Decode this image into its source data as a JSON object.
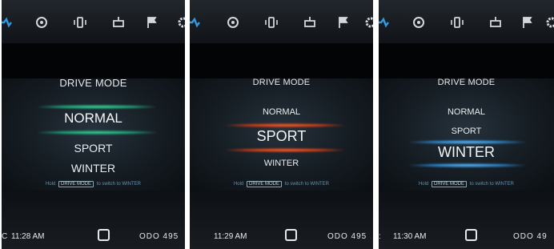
{
  "panels": [
    {
      "title": "DRIVE MODE",
      "options": [
        "NORMAL",
        "SPORT",
        "WINTER"
      ],
      "selected": "NORMAL",
      "selected_color": "#3fe0a4",
      "hint": {
        "prefix": "Hold",
        "key": "DRIVE MODE",
        "suffix": "to switch to WINTER"
      },
      "time": "11:28 AM",
      "odo": "ODO 495"
    },
    {
      "title": "DRIVE MODE",
      "options": [
        "NORMAL",
        "SPORT",
        "WINTER"
      ],
      "selected": "SPORT",
      "selected_color": "#ff6a38",
      "hint": {
        "prefix": "Hold",
        "key": "DRIVE MODE",
        "suffix": "to switch to WINTER"
      },
      "time": "11:29 AM",
      "odo": "ODO 495"
    },
    {
      "title": "DRIVE MODE",
      "options": [
        "NORMAL",
        "SPORT",
        "WINTER"
      ],
      "selected": "WINTER",
      "selected_color": "#6ec6ff",
      "hint": {
        "prefix": "Hold",
        "key": "DRIVE MODE",
        "suffix": "to switch to WINTER"
      },
      "time": "11:30 AM",
      "odo": "ODO 49"
    }
  ],
  "topbar_icons": [
    "drive-assist-icon",
    "tire-pressure-icon",
    "seat-icon",
    "car-status-icon",
    "flag-icon",
    "settings-icon"
  ],
  "accent": "#2f9be0"
}
